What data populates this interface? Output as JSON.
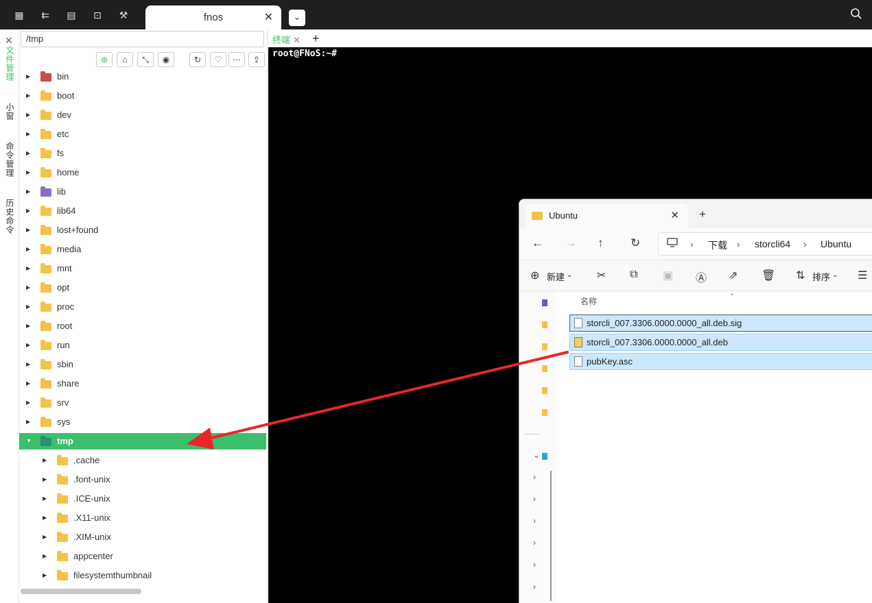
{
  "window": {
    "tab_title": "fnos",
    "tab_close": "✕",
    "tab_dropdown": "⌄",
    "toolbar_icons": [
      "grid-icon",
      "network-icon",
      "files-icon",
      "terminal-icon",
      "wrench-icon"
    ],
    "search_icon": "search-icon"
  },
  "sidebar": {
    "close": "✕",
    "items": [
      {
        "label": "文件管理",
        "active": true
      },
      {
        "label": "小窗",
        "active": false
      },
      {
        "label": "命令管理",
        "active": false
      },
      {
        "label": "历史命令",
        "active": false
      }
    ]
  },
  "filemanager": {
    "path": "/tmp",
    "tools": [
      "locate-icon",
      "home-icon",
      "collapse-icon",
      "eye-icon",
      "refresh-icon",
      "heart-icon",
      "more-icon",
      "upload-icon"
    ],
    "root_items": [
      {
        "name": "bin",
        "icon": "sys"
      },
      {
        "name": "boot",
        "icon": "folder"
      },
      {
        "name": "dev",
        "icon": "folder"
      },
      {
        "name": "etc",
        "icon": "folder"
      },
      {
        "name": "fs",
        "icon": "folder"
      },
      {
        "name": "home",
        "icon": "folder"
      },
      {
        "name": "lib",
        "icon": "lib"
      },
      {
        "name": "lib64",
        "icon": "folder"
      },
      {
        "name": "lost+found",
        "icon": "folder"
      },
      {
        "name": "media",
        "icon": "folder"
      },
      {
        "name": "mnt",
        "icon": "folder"
      },
      {
        "name": "opt",
        "icon": "folder"
      },
      {
        "name": "proc",
        "icon": "folder"
      },
      {
        "name": "root",
        "icon": "folder"
      },
      {
        "name": "run",
        "icon": "folder"
      },
      {
        "name": "sbin",
        "icon": "folder"
      },
      {
        "name": "share",
        "icon": "folder"
      },
      {
        "name": "srv",
        "icon": "folder"
      },
      {
        "name": "sys",
        "icon": "folder"
      },
      {
        "name": "tmp",
        "icon": "tmp",
        "selected": true,
        "expanded": true
      }
    ],
    "tmp_children": [
      ".cache",
      ".font-unix",
      ".ICE-unix",
      ".X11-unix",
      ".XIM-unix",
      "appcenter",
      "filesystemthumbnail"
    ]
  },
  "terminal": {
    "tab_label": "终端",
    "tab_close": "✕",
    "add": "+",
    "prompt": "root@FNoS:~#"
  },
  "explorer": {
    "tab_title": "Ubuntu",
    "tab_close": "✕",
    "add_tab": "+",
    "breadcrumb": [
      "下载",
      "storcli64",
      "Ubuntu"
    ],
    "new_label": "新建",
    "sort_label": "排序",
    "column_name": "名称",
    "files": [
      {
        "name": "storcli_007.3306.0000.0000_all.deb.sig",
        "type": "file"
      },
      {
        "name": "storcli_007.3306.0000.0000_all.deb",
        "type": "deb"
      },
      {
        "name": "pubKey.asc",
        "type": "file"
      }
    ]
  },
  "annotation": {
    "color": "#e8262a"
  }
}
